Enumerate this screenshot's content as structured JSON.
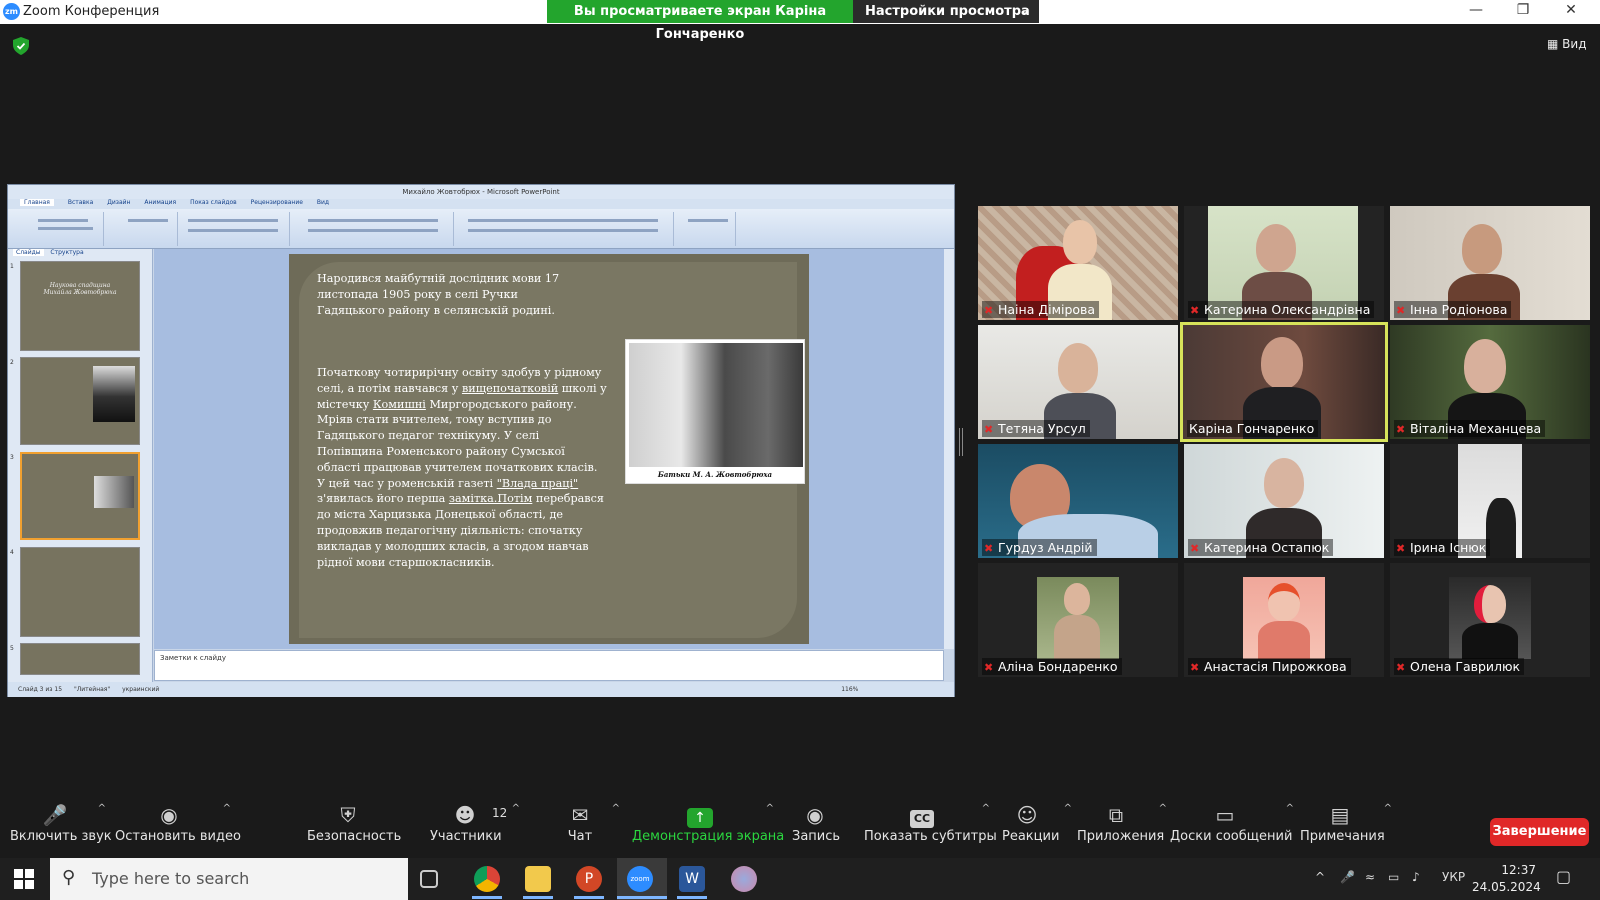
{
  "window": {
    "title": "Zoom Конференция",
    "share_banner": "Вы просматриваете экран Каріна Гончаренко",
    "view_settings": "Настройки просмотра",
    "view_button": "Вид"
  },
  "ppt": {
    "title": "Михайло Жовтобрюх - Microsoft PowerPoint",
    "tabs": [
      "Главная",
      "Вставка",
      "Дизайн",
      "Анимация",
      "Показ слайдов",
      "Рецензирование",
      "Вид"
    ],
    "sidebar_tabs": [
      "Слайды",
      "Структура"
    ],
    "thumb1_title": "Наукова спадщина Михайла Жовтобрюха",
    "notes_placeholder": "Заметки к слайду",
    "status_slide": "Слайд 3 из 15",
    "status_theme": "\"Литейная\"",
    "status_lang": "украинский",
    "zoom": "116%"
  },
  "slide": {
    "para1": "Народився майбутній дослідник мови 17 листопада 1905 року в селі Ручки Гадяцького району в селянській родині.",
    "para2_a": "Початкову чотирирічну освіту здобув у рідному селі, а потім навчався у ",
    "para2_link1": "вищепочатковій",
    "para2_b": " школі у містечку ",
    "para2_link2": "Комишні",
    "para2_c": " Миргородського району. Мріяв стати вчителем, тому вступив до Гадяцького педагог технікуму. У селі Попівщина Роменського району Сумської області працював учителем початкових класів. У цей час у роменській газеті ",
    "para2_link3": "\"Влада праці\"",
    "para2_d": " з'явилась його перша ",
    "para2_link4": "замітка.Потім",
    "para2_e": " перебрався до міста Харцизька Донецької області, де продовжив  педагогічну діяльність: спочатку викладав у молодших класів, а згодом навчав рідної мови старшокласників.",
    "photo_caption": "Батьки М. А. Жовтобрюха"
  },
  "participants": [
    {
      "name": "Наіна Дімірова",
      "muted": true
    },
    {
      "name": "Катерина Олександрівна",
      "muted": true
    },
    {
      "name": "Інна Родіонова",
      "muted": true
    },
    {
      "name": "Тетяна Урсул",
      "muted": true
    },
    {
      "name": "Каріна Гончаренко",
      "muted": false
    },
    {
      "name": "Віталіна Механцева",
      "muted": true
    },
    {
      "name": "Гурдуз Андрій",
      "muted": true
    },
    {
      "name": "Катерина Остапюк",
      "muted": true
    },
    {
      "name": "Ірина Існюк",
      "muted": true
    },
    {
      "name": "Аліна Бондаренко",
      "muted": true
    },
    {
      "name": "Анастасія Пирожкова",
      "muted": true
    },
    {
      "name": "Олена Гаврилюк",
      "muted": true
    }
  ],
  "toolbar": {
    "unmute": "Включить звук",
    "video": "Остановить видео",
    "security": "Безопасность",
    "participants": "Участники",
    "participants_count": "12",
    "chat": "Чат",
    "share": "Демонстрация экрана",
    "record": "Запись",
    "captions": "Показать субтитры",
    "reactions": "Реакции",
    "apps": "Приложения",
    "whiteboards": "Доски сообщений",
    "notes": "Примечания",
    "end": "Завершение"
  },
  "taskbar": {
    "search_placeholder": "Type here to search",
    "language": "УКР",
    "time": "12:37",
    "date": "24.05.2024"
  },
  "colors": {
    "share_green": "#23a52d",
    "end_red": "#e02828",
    "active_speaker": "#d7e35a"
  }
}
